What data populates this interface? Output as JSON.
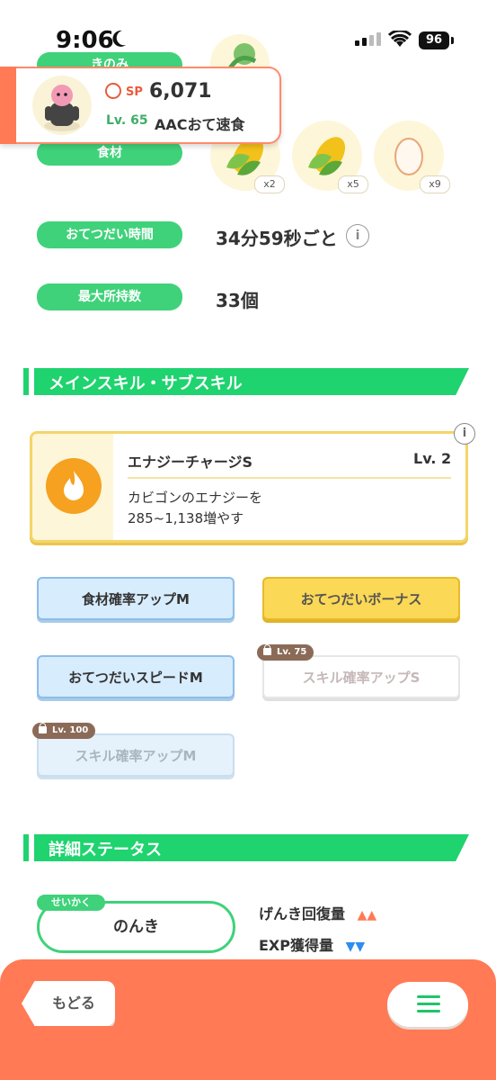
{
  "status_bar": {
    "time": "9:06",
    "battery": "96"
  },
  "top_rows": {
    "berry_label": "きのみ",
    "ingredient_label": "食材",
    "ingredients": [
      {
        "icon": "corn-icon",
        "count": "x2"
      },
      {
        "icon": "corn-icon",
        "count": "x5"
      },
      {
        "icon": "egg-icon",
        "count": "x9"
      }
    ]
  },
  "pokemon_card": {
    "sp_label": "SP",
    "sp_value": "6,071",
    "level_label": "Lv. 65",
    "name": "AACおて速食"
  },
  "stats": {
    "help_time_label": "おてつだい時間",
    "help_time_value": "34分59秒ごと",
    "max_carry_label": "最大所持数",
    "max_carry_value": "33個"
  },
  "skills_section": {
    "title": "メインスキル・サブスキル",
    "main_skill": {
      "name": "エナジーチャージS",
      "level": "Lv. 2",
      "description_line1": "カビゴンのエナジーを",
      "description_line2": "285~1,138増やす"
    },
    "sub_skills": [
      {
        "label": "食材確率アップM",
        "locked": false
      },
      {
        "label": "おてつだいボーナス",
        "locked": false
      },
      {
        "label": "おてつだいスピードM",
        "locked": false
      },
      {
        "label": "スキル確率アップS",
        "locked": true,
        "lock_level": "Lv. 75"
      },
      {
        "label": "スキル確率アップM",
        "locked": true,
        "lock_level": "Lv. 100"
      }
    ]
  },
  "details_section": {
    "title": "詳細ステータス",
    "nature_tag": "せいかく",
    "nature": "のんき",
    "energy_recovery_label": "げんき回復量",
    "energy_recovery_arrows": "▲▲",
    "exp_label": "EXP獲得量",
    "exp_arrows": "▼▼"
  },
  "bottom_bar": {
    "back_label": "もどる"
  },
  "colors": {
    "accent_green": "#3fd27a",
    "bottom_orange": "#ff7a55",
    "up_arrow": "#ff7a55",
    "down_arrow": "#2e8df0"
  }
}
